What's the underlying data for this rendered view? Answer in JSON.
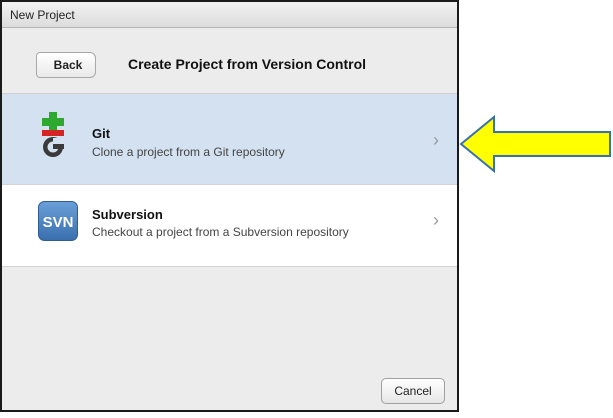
{
  "window": {
    "title": "New Project"
  },
  "header": {
    "back_label": "Back",
    "title": "Create Project from Version Control"
  },
  "options": [
    {
      "name": "Git",
      "description": "Clone a project from a Git repository",
      "icon": "git-icon",
      "selected": true
    },
    {
      "name": "Subversion",
      "description": "Checkout a project from a Subversion repository",
      "icon": "svn-icon",
      "icon_text": "SVN",
      "selected": false
    }
  ],
  "footer": {
    "cancel_label": "Cancel"
  },
  "annotation": {
    "arrow_color": "#ffff00",
    "arrow_outline": "#3b6fb0",
    "points_to": "Git"
  },
  "colors": {
    "selected_row": "#d3e1f0",
    "svn_icon_bg": "#4a80c0",
    "git_plus": "#2fa82f",
    "git_minus": "#d42424"
  }
}
